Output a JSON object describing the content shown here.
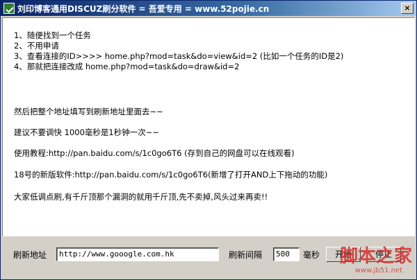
{
  "window": {
    "title": "刘印博客通用DISCUZ刷分软件 =  吾爱专用 = www.52pojie.cn",
    "close_glyph": "×",
    "icon": "app-check-icon"
  },
  "content": {
    "lines": [
      "1、随便找到一个任务",
      "2、不用申请",
      "3、查看连接的ID>>>> home.php?mod=task&do=view&id=2  (比如一个任务的ID是2)",
      "4、那就把连接改成 home.php?mod=task&do=draw&id=2",
      "然后把整个地址填写到刷新地址里面去~~",
      "建议不要调快 1000毫秒是1秒钟一次~~",
      "使用教程:http://pan.baidu.com/s/1c0go6T6  (存到自己的网盘可以在线观看)",
      "18号的新版软件:http://pan.baidu.com/s/1c0go6T6(新增了打开AND上下拖动的功能)",
      "大家低调点刷,有千斤顶那个漏洞的就用千斤顶,先不卖掉,风头过来再卖!!"
    ]
  },
  "controls": {
    "refresh_url_label": "刷新地址",
    "refresh_url_value": "http://www.gooogle.com.hk",
    "interval_label": "刷新间隔",
    "interval_value": "500",
    "unit_label": "毫秒",
    "start_button": "开始",
    "stop_button": "停止"
  },
  "watermark": {
    "main": "脚本之家",
    "sub": "www.jb51.net"
  }
}
